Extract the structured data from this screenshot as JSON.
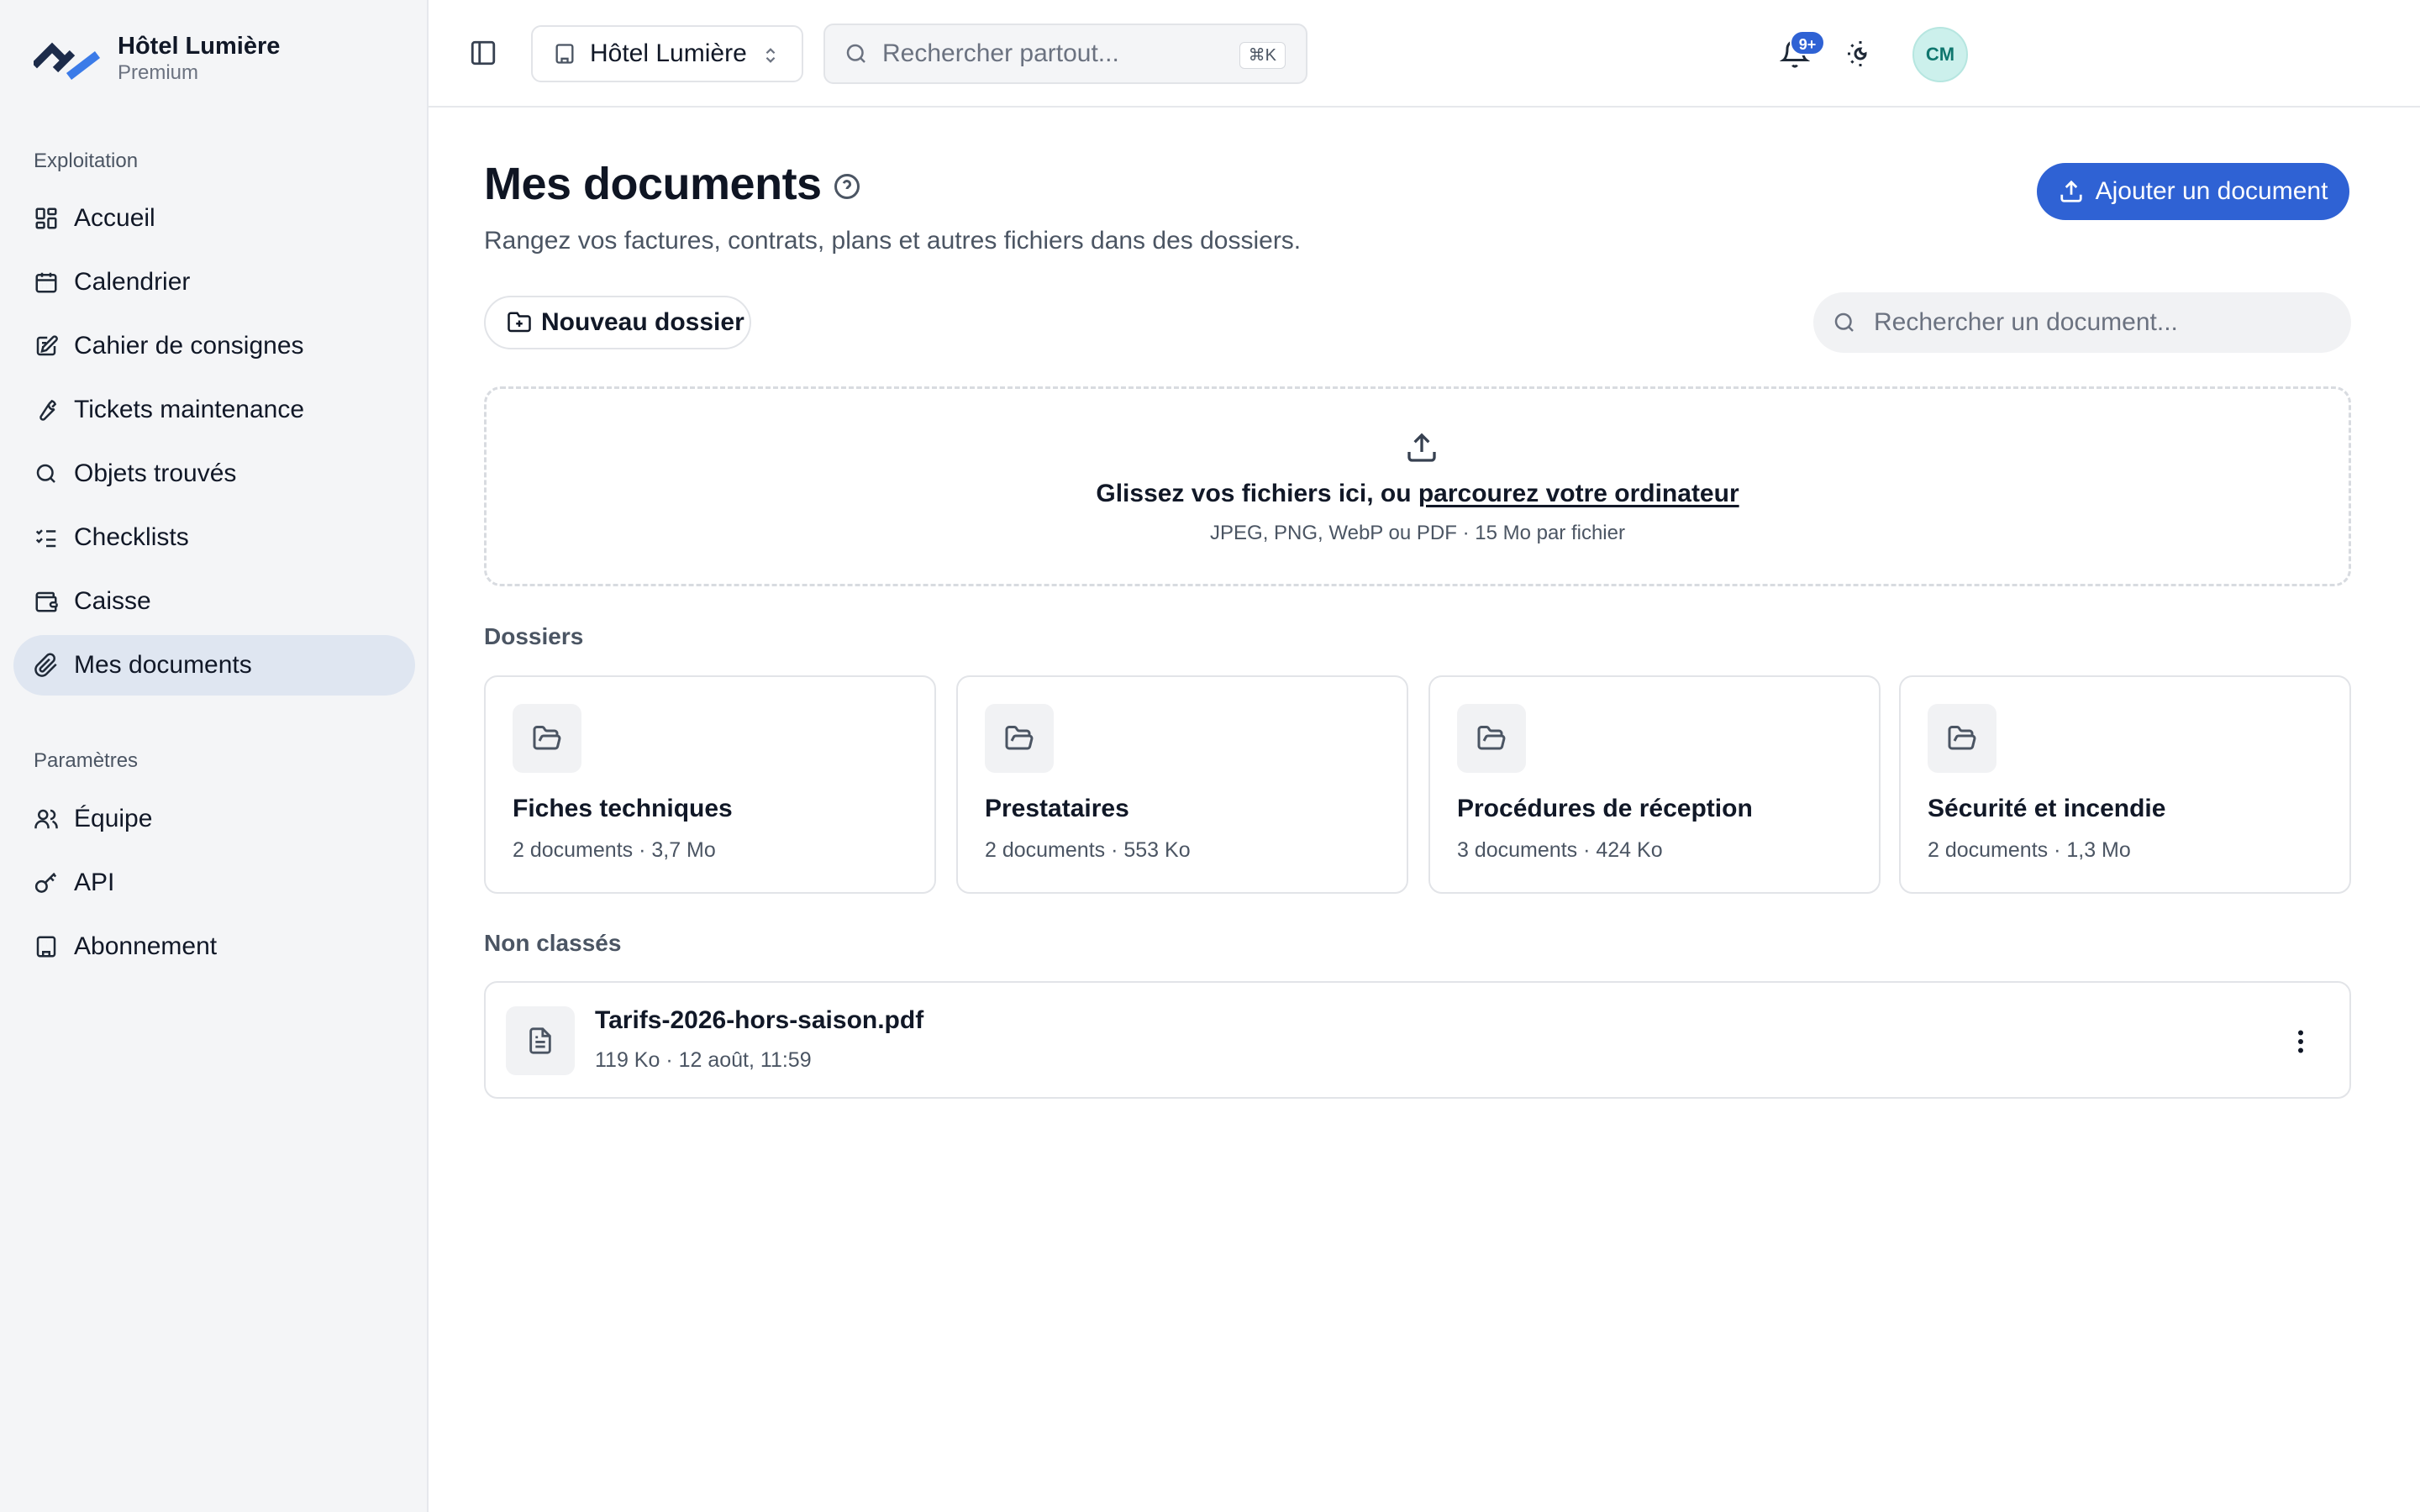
{
  "brand": {
    "name": "Hôtel Lumière",
    "plan": "Premium"
  },
  "sidebar": {
    "sections": [
      {
        "title": "Exploitation"
      },
      {
        "title": "Paramètres"
      }
    ],
    "items": [
      {
        "label": "Accueil",
        "icon": "dashboard-icon"
      },
      {
        "label": "Calendrier",
        "icon": "calendar-icon"
      },
      {
        "label": "Cahier de consignes",
        "icon": "notebook-icon"
      },
      {
        "label": "Tickets maintenance",
        "icon": "wrench-icon"
      },
      {
        "label": "Objets trouvés",
        "icon": "search-icon"
      },
      {
        "label": "Checklists",
        "icon": "checklist-icon"
      },
      {
        "label": "Caisse",
        "icon": "wallet-icon"
      },
      {
        "label": "Mes documents",
        "icon": "paperclip-icon",
        "active": true
      },
      {
        "label": "Équipe",
        "icon": "users-icon"
      },
      {
        "label": "API",
        "icon": "key-icon"
      },
      {
        "label": "Abonnement",
        "icon": "building-icon"
      }
    ]
  },
  "topbar": {
    "hotel_select": "Hôtel Lumière",
    "search_placeholder": "Rechercher partout...",
    "search_shortcut": "⌘K",
    "notification_count": "9+",
    "avatar_initials": "CM"
  },
  "main": {
    "title": "Mes documents",
    "subtitle": "Rangez vos factures, contrats, plans et autres fichiers dans des dossiers.",
    "add_button": "Ajouter un document",
    "new_folder_button": "Nouveau dossier",
    "doc_search_placeholder": "Rechercher un document...",
    "dropzone": {
      "text": "Glissez vos fichiers ici, ou ",
      "link": "parcourez votre ordinateur",
      "hint": "JPEG, PNG, WebP ou PDF · 15 Mo par fichier"
    },
    "folders_label": "Dossiers",
    "folders": [
      {
        "name": "Fiches techniques",
        "meta": "2 documents · 3,7 Mo"
      },
      {
        "name": "Prestataires",
        "meta": "2 documents · 553 Ko"
      },
      {
        "name": "Procédures de réception",
        "meta": "3 documents · 424 Ko"
      },
      {
        "name": "Sécurité et incendie",
        "meta": "2 documents · 1,3 Mo"
      }
    ],
    "unsorted_label": "Non classés",
    "files": [
      {
        "name": "Tarifs-2026-hors-saison.pdf",
        "meta": "119 Ko · 12 août, 11:59"
      }
    ]
  },
  "colors": {
    "accent": "#2f62d4",
    "active_nav": "#dfe6f1",
    "avatar_bg": "#ccf0ec"
  }
}
